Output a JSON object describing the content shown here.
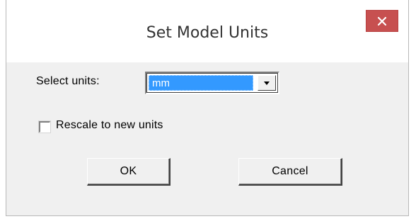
{
  "dialog": {
    "title": "Set Model Units",
    "close_icon": "close-icon",
    "close_color": "#c75050"
  },
  "units": {
    "label": "Select units:",
    "selected_value": "mm",
    "dropdown_icon": "chevron-down-icon",
    "highlight_color": "#3399ff"
  },
  "rescale": {
    "label": "Rescale to new units",
    "checked": false
  },
  "buttons": {
    "ok_label": "OK",
    "cancel_label": "Cancel"
  }
}
